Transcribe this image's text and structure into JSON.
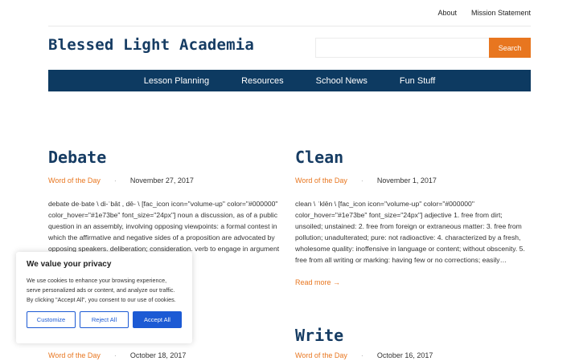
{
  "topbar": {
    "links": [
      "About",
      "Mission Statement"
    ]
  },
  "brand": {
    "title": "Blessed Light Academia"
  },
  "search": {
    "placeholder": "",
    "button_label": "Search"
  },
  "nav": {
    "items": [
      "Lesson Planning",
      "Resources",
      "School News",
      "Fun Stuff"
    ]
  },
  "posts": [
    {
      "title": "Debate",
      "category": "Word of the Day",
      "date": "November 27, 2017",
      "excerpt": "debate de·bate \\ di-ˈbāt , dē- \\ [fac_icon icon=\"volume-up\" color=\"#000000\" color_hover=\"#1e73be\" font_size=\"24px\"] noun a discussion, as of a public question in an assembly, involving opposing viewpoints: a formal contest in which the affirmative and negative sides of a proposition are advocated by opposing speakers. deliberation; consideration. verb to engage in argument"
    },
    {
      "title": "Clean",
      "category": "Word of the Day",
      "date": "November 1, 2017",
      "excerpt": "clean \\ ˈklēn \\ [fac_icon icon=\"volume-up\" color=\"#000000\" color_hover=\"#1e73be\" font_size=\"24px\"] adjective 1. free from dirt; unsoiled; unstained: 2. free from foreign or extraneous matter: 3. free from pollution; unadulterated; pure: not radioactive: 4. characterized by a fresh, wholesome quality: inoffensive in language or content; without obscenity. 5. free from all writing or marking: having few or no corrections; easily…",
      "read_more": "Read more →"
    },
    {
      "title": "",
      "category": "Word of the Day",
      "date": "October 18, 2017"
    },
    {
      "title": "Write",
      "category": "Word of the Day",
      "date": "October 16, 2017"
    }
  ],
  "meta_separator": "·",
  "cookie": {
    "title": "We value your privacy",
    "body": "We use cookies to enhance your browsing experience, serve personalized ads or content, and analyze our traffic. By clicking \"Accept All\", you consent to our use of cookies.",
    "customize": "Customize",
    "reject": "Reject All",
    "accept": "Accept All"
  },
  "colors": {
    "brand": "#163c63",
    "nav_bg": "#0d3a61",
    "accent": "#e8761f",
    "cookie_btn": "#1c5ad4"
  }
}
